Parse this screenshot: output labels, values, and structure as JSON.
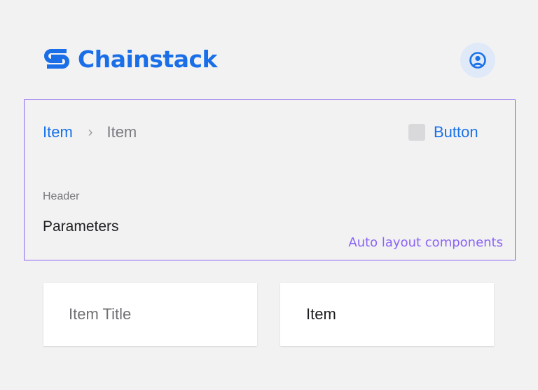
{
  "brand": {
    "name": "Chainstack",
    "color": "#1a6fe8",
    "logo_icon": "chainstack-logo-icon"
  },
  "header": {
    "avatar_icon": "user-circle-icon"
  },
  "breadcrumb": {
    "items": [
      {
        "label": "Item"
      },
      {
        "label": "Item"
      }
    ],
    "separator_icon": "chevron-right-icon"
  },
  "action": {
    "label": "Button",
    "icon": "square-placeholder-icon"
  },
  "section": {
    "label": "Header",
    "title": "Parameters"
  },
  "annotation": {
    "caption": "Auto layout components",
    "color": "#8a63f5"
  },
  "cards": [
    {
      "text": "Item Title"
    },
    {
      "text": "Item"
    }
  ]
}
